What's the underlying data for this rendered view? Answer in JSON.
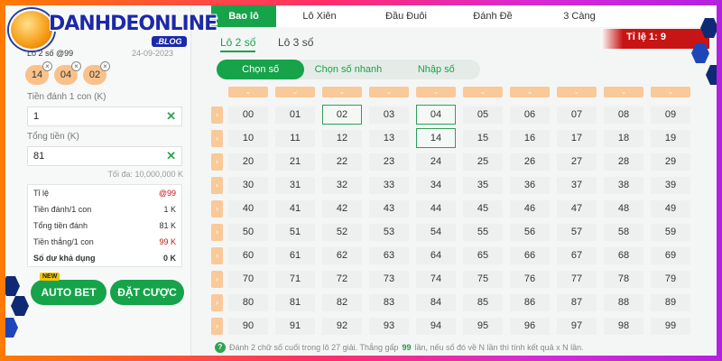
{
  "brand": {
    "name": "DANHDEONLINE",
    "tag": ".BLOG"
  },
  "bet_panel": {
    "title": "Lô 2 số @99",
    "date": "24-09-2023",
    "chips": [
      "14",
      "04",
      "02"
    ],
    "amount_label": "Tiền đánh 1 con (K)",
    "amount_value": "1",
    "total_label": "Tổng tiền (K)",
    "total_value": "81",
    "max_note": "Tối đa: 10,000,000 K",
    "stats": [
      {
        "label": "Tỉ lệ",
        "value": "@99"
      },
      {
        "label": "Tiền đánh/1 con",
        "value": "1 K"
      },
      {
        "label": "Tổng tiền đánh",
        "value": "81 K"
      },
      {
        "label": "Tiền thắng/1 con",
        "value": "99 K"
      },
      {
        "label": "Số dư khả dụng",
        "value": "0 K"
      }
    ],
    "new_badge": "NEW",
    "auto_bet": "AUTO BET",
    "place_bet": "ĐẶT CƯỢC"
  },
  "tabs": [
    "Bao lô",
    "Lô Xiên",
    "Đầu Đuôi",
    "Đánh Đề",
    "3 Càng"
  ],
  "subtabs": [
    "Lô 2 số",
    "Lô 3 số"
  ],
  "rate": "Tỉ lệ 1: 9",
  "modes": [
    "Chọn số",
    "Chọn số nhanh",
    "Nhập số"
  ],
  "numbers": [
    [
      "00",
      "01",
      "02",
      "03",
      "04",
      "05",
      "06",
      "07",
      "08",
      "09"
    ],
    [
      "10",
      "11",
      "12",
      "13",
      "14",
      "15",
      "16",
      "17",
      "18",
      "19"
    ],
    [
      "20",
      "21",
      "22",
      "23",
      "24",
      "25",
      "26",
      "27",
      "28",
      "29"
    ],
    [
      "30",
      "31",
      "32",
      "33",
      "34",
      "35",
      "36",
      "37",
      "38",
      "39"
    ],
    [
      "40",
      "41",
      "42",
      "43",
      "44",
      "45",
      "46",
      "47",
      "48",
      "49"
    ],
    [
      "50",
      "51",
      "52",
      "53",
      "54",
      "55",
      "56",
      "57",
      "58",
      "59"
    ],
    [
      "60",
      "61",
      "62",
      "63",
      "64",
      "65",
      "66",
      "67",
      "68",
      "69"
    ],
    [
      "70",
      "71",
      "72",
      "73",
      "74",
      "75",
      "76",
      "77",
      "78",
      "79"
    ],
    [
      "80",
      "81",
      "82",
      "83",
      "84",
      "85",
      "86",
      "87",
      "88",
      "89"
    ],
    [
      "90",
      "91",
      "92",
      "93",
      "94",
      "95",
      "96",
      "97",
      "98",
      "99"
    ]
  ],
  "selected": [
    "02",
    "04",
    "14"
  ],
  "note": {
    "before": "Đánh 2 chữ số cuối trong lô 27 giải. Thắng gấp",
    "highlight": "99",
    "after": "lần, nếu số đó về N lần thì tính kết quả x N lần."
  },
  "colors": {
    "accent": "#16a34a",
    "chip": "#fbc18a",
    "arrow": "#f9c999",
    "rate_bg": "#c71515"
  }
}
